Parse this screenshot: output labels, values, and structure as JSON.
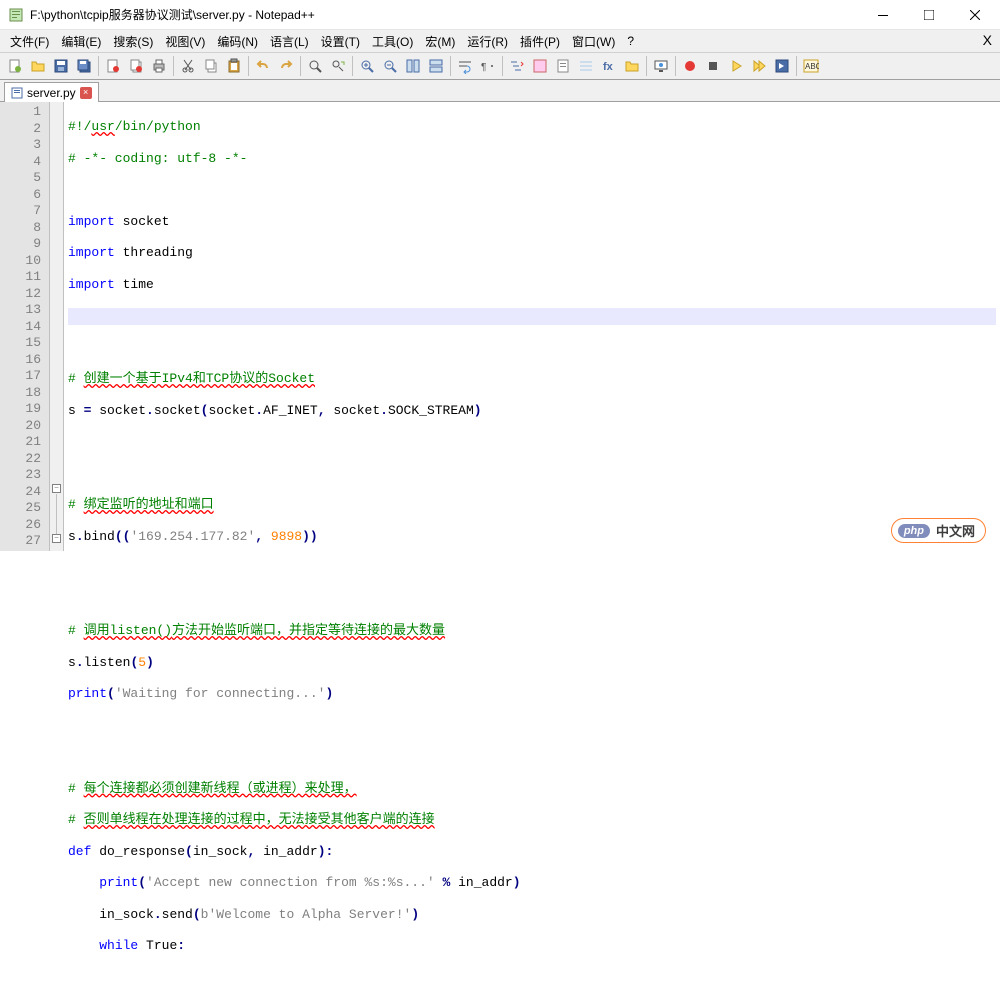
{
  "window": {
    "title": "F:\\python\\tcpip服务器协议测试\\server.py - Notepad++"
  },
  "menu": {
    "items": [
      {
        "label": "文件(F)"
      },
      {
        "label": "编辑(E)"
      },
      {
        "label": "搜索(S)"
      },
      {
        "label": "视图(V)"
      },
      {
        "label": "编码(N)"
      },
      {
        "label": "语言(L)"
      },
      {
        "label": "设置(T)"
      },
      {
        "label": "工具(O)"
      },
      {
        "label": "宏(M)"
      },
      {
        "label": "运行(R)"
      },
      {
        "label": "插件(P)"
      },
      {
        "label": "窗口(W)"
      },
      {
        "label": "?"
      }
    ]
  },
  "tabs": {
    "items": [
      {
        "label": "server.py",
        "active": true
      }
    ]
  },
  "editor": {
    "current_line": 7,
    "lines": [
      {
        "n": 1
      },
      {
        "n": 2
      },
      {
        "n": 3
      },
      {
        "n": 4
      },
      {
        "n": 5
      },
      {
        "n": 6
      },
      {
        "n": 7
      },
      {
        "n": 8
      },
      {
        "n": 9
      },
      {
        "n": 10
      },
      {
        "n": 11
      },
      {
        "n": 12
      },
      {
        "n": 13
      },
      {
        "n": 14
      },
      {
        "n": 15
      },
      {
        "n": 16
      },
      {
        "n": 17
      },
      {
        "n": 18
      },
      {
        "n": 19
      },
      {
        "n": 20
      },
      {
        "n": 21
      },
      {
        "n": 22
      },
      {
        "n": 23
      },
      {
        "n": 24
      },
      {
        "n": 25
      },
      {
        "n": 26
      },
      {
        "n": 27
      }
    ],
    "code": {
      "l1_a": "#!/",
      "l1_b": "usr",
      "l1_c": "/bin/python",
      "l2_a": "# -*- coding: utf-8 -*-",
      "l4_a": "import",
      "l4_b": " socket",
      "l5_a": "import",
      "l5_b": " threading",
      "l6_a": "import",
      "l6_b": " time",
      "l9_a": "# ",
      "l9_b": "创建一个基于IPv4和TCP协议的Socket",
      "l10_a": "s ",
      "l10_b": "=",
      "l10_c": " socket",
      "l10_d": ".",
      "l10_e": "socket",
      "l10_f": "(",
      "l10_g": "socket",
      "l10_h": ".",
      "l10_i": "AF_INET",
      "l10_j": ",",
      "l10_k": " socket",
      "l10_l": ".",
      "l10_m": "SOCK_STREAM",
      "l10_n": ")",
      "l13_a": "# ",
      "l13_b": "绑定监听的地址和端口",
      "l14_a": "s",
      "l14_b": ".",
      "l14_c": "bind",
      "l14_d": "((",
      "l14_e": "'169.254.177.82'",
      "l14_f": ",",
      "l14_g": " ",
      "l14_h": "9898",
      "l14_i": "))",
      "l17_a": "# ",
      "l17_b": "调用listen()",
      "l17_c": "方法开始监听端口，并指定等待连接的最大数量",
      "l18_a": "s",
      "l18_b": ".",
      "l18_c": "listen",
      "l18_d": "(",
      "l18_e": "5",
      "l18_f": ")",
      "l19_a": "print",
      "l19_b": "(",
      "l19_c": "'Waiting for connecting...'",
      "l19_d": ")",
      "l22_a": "# ",
      "l22_b": "每个连接都必须创建新线程（或进程）来处理，",
      "l23_a": "# ",
      "l23_b": "否则单线程在处理连接的过程中，无法接受其他客户端的连接",
      "l24_a": "def",
      "l24_b": " do_response",
      "l24_c": "(",
      "l24_d": "in_sock",
      "l24_e": ",",
      "l24_f": " in_addr",
      "l24_g": "):",
      "l25_a": "    ",
      "l25_b": "print",
      "l25_c": "(",
      "l25_d": "'Accept new connection from %s:%s...'",
      "l25_e": " ",
      "l25_f": "%",
      "l25_g": " in_addr",
      "l25_h": ")",
      "l26_a": "    in_sock",
      "l26_b": ".",
      "l26_c": "send",
      "l26_d": "(",
      "l26_e": "b'Welcome to Alpha Server!'",
      "l26_f": ")",
      "l27_a": "    ",
      "l27_b": "while",
      "l27_c": " True",
      "l27_d": ":"
    }
  },
  "watermark": {
    "php": "php",
    "text": "中文网"
  }
}
